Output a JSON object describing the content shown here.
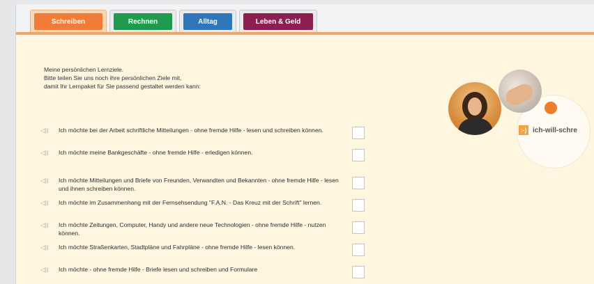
{
  "tabs": [
    {
      "label": "Schreiben",
      "color": "#f07c38",
      "active": true
    },
    {
      "label": "Rechnen",
      "color": "#1f9a4f"
    },
    {
      "label": "Alltag",
      "color": "#2f76b8"
    },
    {
      "label": "Leben & Geld",
      "color": "#8c1f52"
    }
  ],
  "intro": {
    "line1": "Meine persönlichen Lernziele.",
    "line2": "Bitte teilen Sie uns noch ihre persönlichen Ziele mit,",
    "line3": "damit Ihr Lernpaket für Sie passend gestaltet werden kann:"
  },
  "goals": [
    {
      "text": "Ich möchte bei der Arbeit schriftliche Mitteilungen - ohne fremde Hilfe - lesen und schreiben können."
    },
    {
      "text": "Ich möchte meine Bankgeschäfte - ohne fremde Hilfe - erledigen können."
    },
    {
      "text": "Ich möchte Mitteilungen und Briefe von Freunden, Verwandten und Bekannten - ohne fremde Hilfe - lesen und ihnen schreiben können."
    },
    {
      "text": "Ich möchte im Zusammenhang mit der Fernsehsendung \"F.A.N. - Das Kreuz mit der Schrift\" lernen."
    },
    {
      "text": "Ich möchte Zeitungen, Computer, Handy und andere neue Technologien - ohne fremde Hilfe - nutzen können."
    },
    {
      "text": "Ich möchte Straßenkarten, Stadtpläne und Fahrpläne - ohne fremde Hilfe - lesen können."
    },
    {
      "text": "Ich möchte - ohne fremde Hilfe - Briefe lesen und schreiben und Formulare"
    }
  ],
  "brand": {
    "icon_text": ":-)",
    "text": "ich-will-schre"
  },
  "icons": {
    "speaker": "speaker-icon"
  }
}
